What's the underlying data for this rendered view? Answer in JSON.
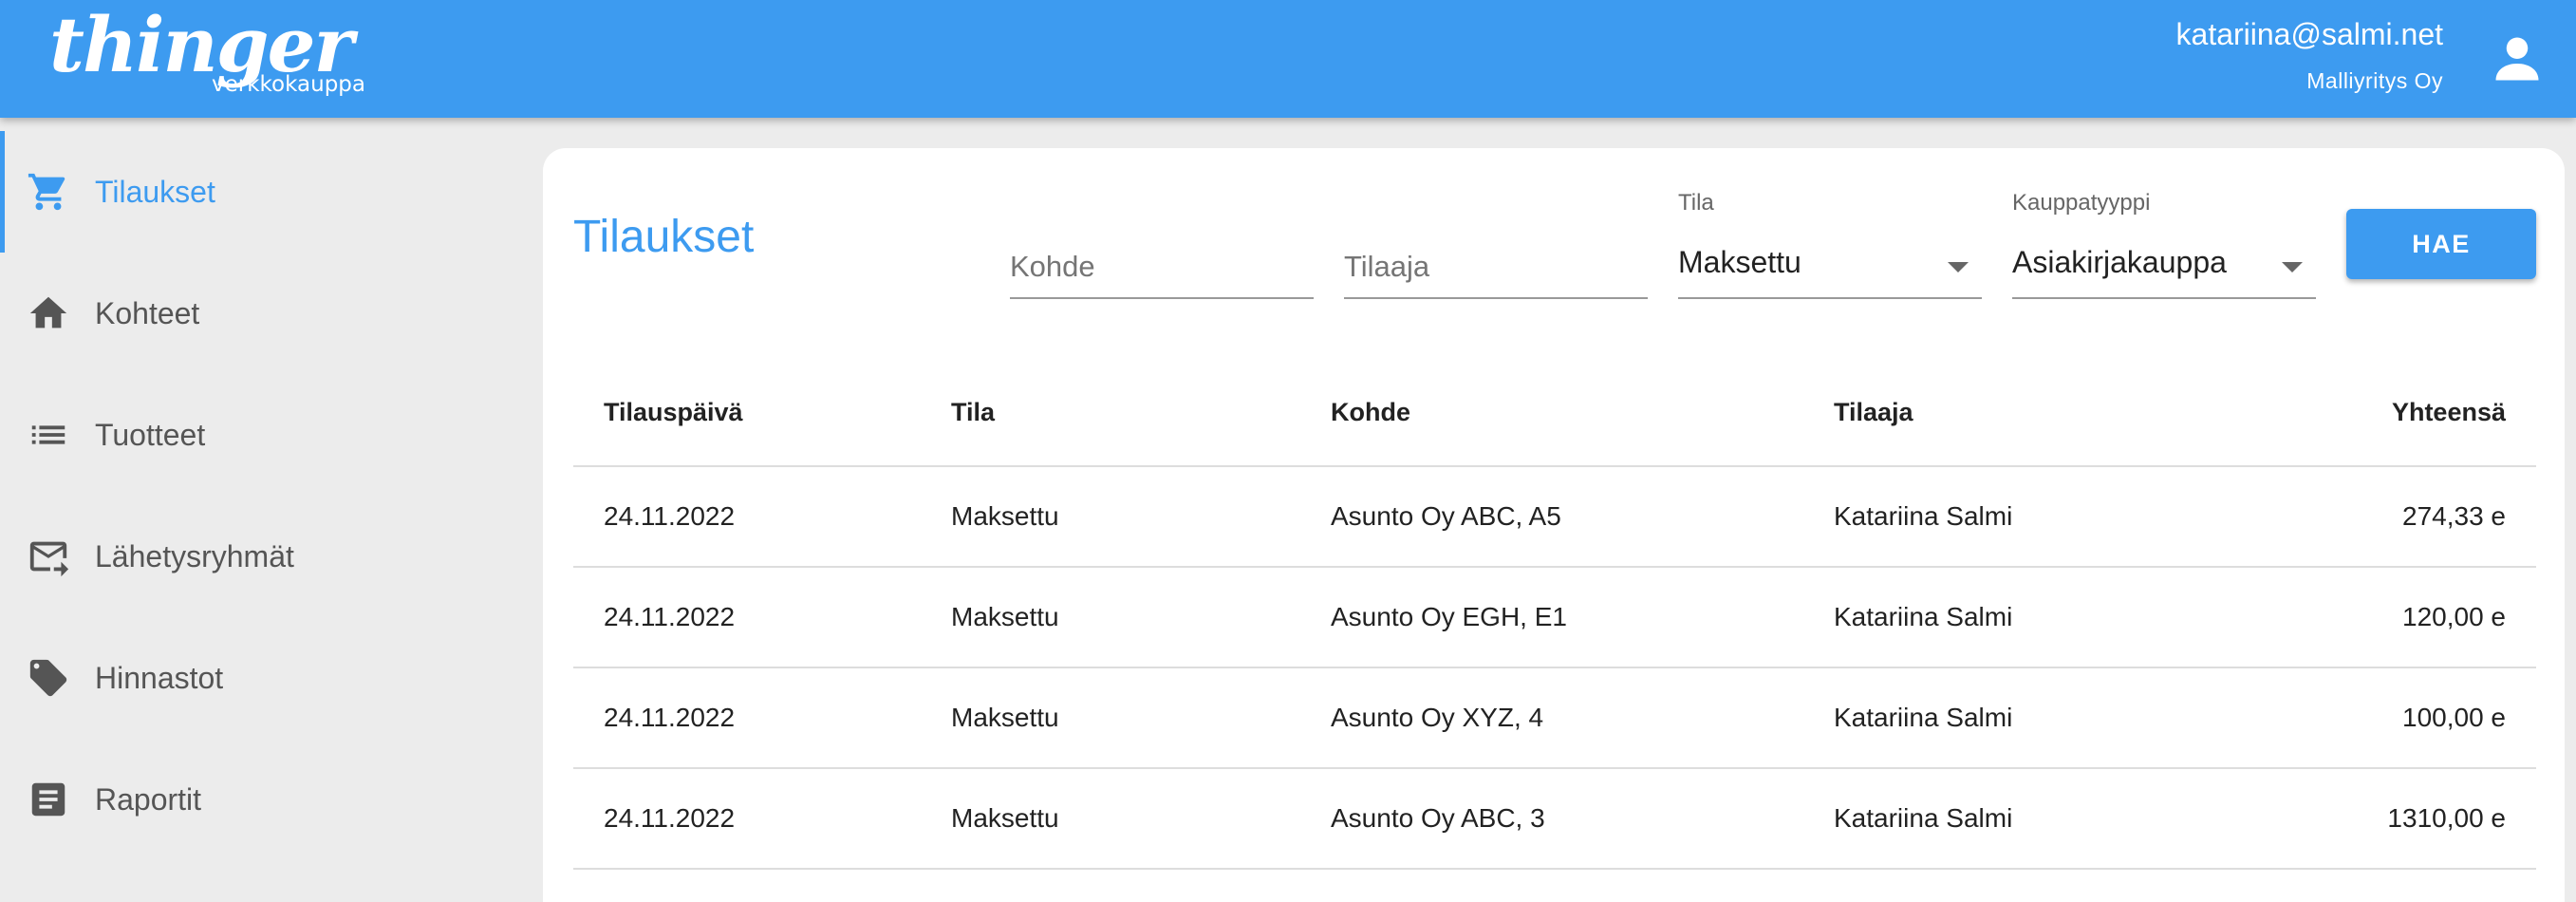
{
  "header": {
    "logo": "thinger",
    "logo_sub": "verkkokauppa",
    "user_email": "katariina@salmi.net",
    "user_company": "Malliyritys Oy",
    "accent_color": "#3d9bf0"
  },
  "sidebar": {
    "items": [
      {
        "label": "Tilaukset",
        "icon": "cart-icon",
        "active": true
      },
      {
        "label": "Kohteet",
        "icon": "home-icon",
        "active": false
      },
      {
        "label": "Tuotteet",
        "icon": "list-icon",
        "active": false
      },
      {
        "label": "Lähetysryhmät",
        "icon": "mail-send-icon",
        "active": false
      },
      {
        "label": "Hinnastot",
        "icon": "tag-icon",
        "active": false
      },
      {
        "label": "Raportit",
        "icon": "report-icon",
        "active": false
      }
    ]
  },
  "main": {
    "title": "Tilaukset",
    "filters": {
      "kohde_placeholder": "Kohde",
      "tilaaja_placeholder": "Tilaaja",
      "tila_label": "Tila",
      "tila_value": "Maksettu",
      "kauppatyyppi_label": "Kauppatyyppi",
      "kauppatyyppi_value": "Asiakirjakauppa",
      "search_label": "HAE"
    },
    "table": {
      "columns": [
        "Tilauspäivä",
        "Tila",
        "Kohde",
        "Tilaaja",
        "Yhteensä"
      ],
      "rows": [
        [
          "24.11.2022",
          "Maksettu",
          "Asunto Oy ABC, A5",
          "Katariina Salmi",
          "274,33 e"
        ],
        [
          "24.11.2022",
          "Maksettu",
          "Asunto Oy EGH, E1",
          "Katariina Salmi",
          "120,00 e"
        ],
        [
          "24.11.2022",
          "Maksettu",
          "Asunto Oy XYZ, 4",
          "Katariina Salmi",
          "100,00 e"
        ],
        [
          "24.11.2022",
          "Maksettu",
          "Asunto Oy ABC, 3",
          "Katariina Salmi",
          "1310,00 e"
        ]
      ]
    }
  }
}
